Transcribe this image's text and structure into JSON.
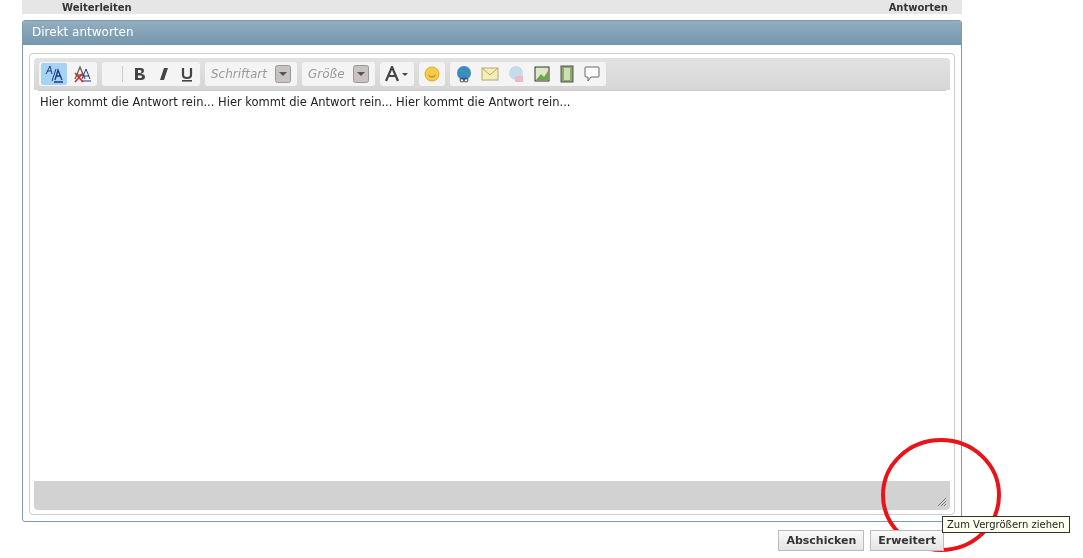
{
  "top_bar": {
    "left_action": "Weiterleiten",
    "right_action": "Antworten"
  },
  "panel": {
    "title": "Direkt antworten"
  },
  "toolbar": {
    "groups": [
      {
        "items": [
          {
            "kind": "wysiwyg",
            "selected": true
          },
          {
            "kind": "remove-format",
            "selected": false
          }
        ]
      },
      {
        "items": [
          {
            "kind": "blank",
            "selected": false
          },
          {
            "kind": "bold",
            "selected": false
          },
          {
            "kind": "italic",
            "selected": false
          },
          {
            "kind": "underline",
            "selected": false
          }
        ]
      },
      {
        "items": [
          {
            "kind": "dropdown",
            "placeholder": "Schriftart"
          }
        ]
      },
      {
        "items": [
          {
            "kind": "dropdown",
            "placeholder": "Größe"
          }
        ]
      },
      {
        "items": [
          {
            "kind": "color",
            "selected": false
          }
        ]
      },
      {
        "items": [
          {
            "kind": "smiley",
            "selected": false
          }
        ]
      },
      {
        "items": [
          {
            "kind": "link",
            "selected": false
          },
          {
            "kind": "email",
            "selected": false
          },
          {
            "kind": "globe",
            "selected": false
          },
          {
            "kind": "image",
            "selected": false
          },
          {
            "kind": "video",
            "selected": false
          },
          {
            "kind": "quote",
            "selected": false
          }
        ]
      }
    ]
  },
  "editor": {
    "value": "Hier kommt die Antwort rein... Hier kommt die Antwort rein... Hier kommt die Antwort rein..."
  },
  "buttons": [
    "Abschicken",
    "Erweitert"
  ],
  "tooltip": "Zum Vergrößern ziehen"
}
